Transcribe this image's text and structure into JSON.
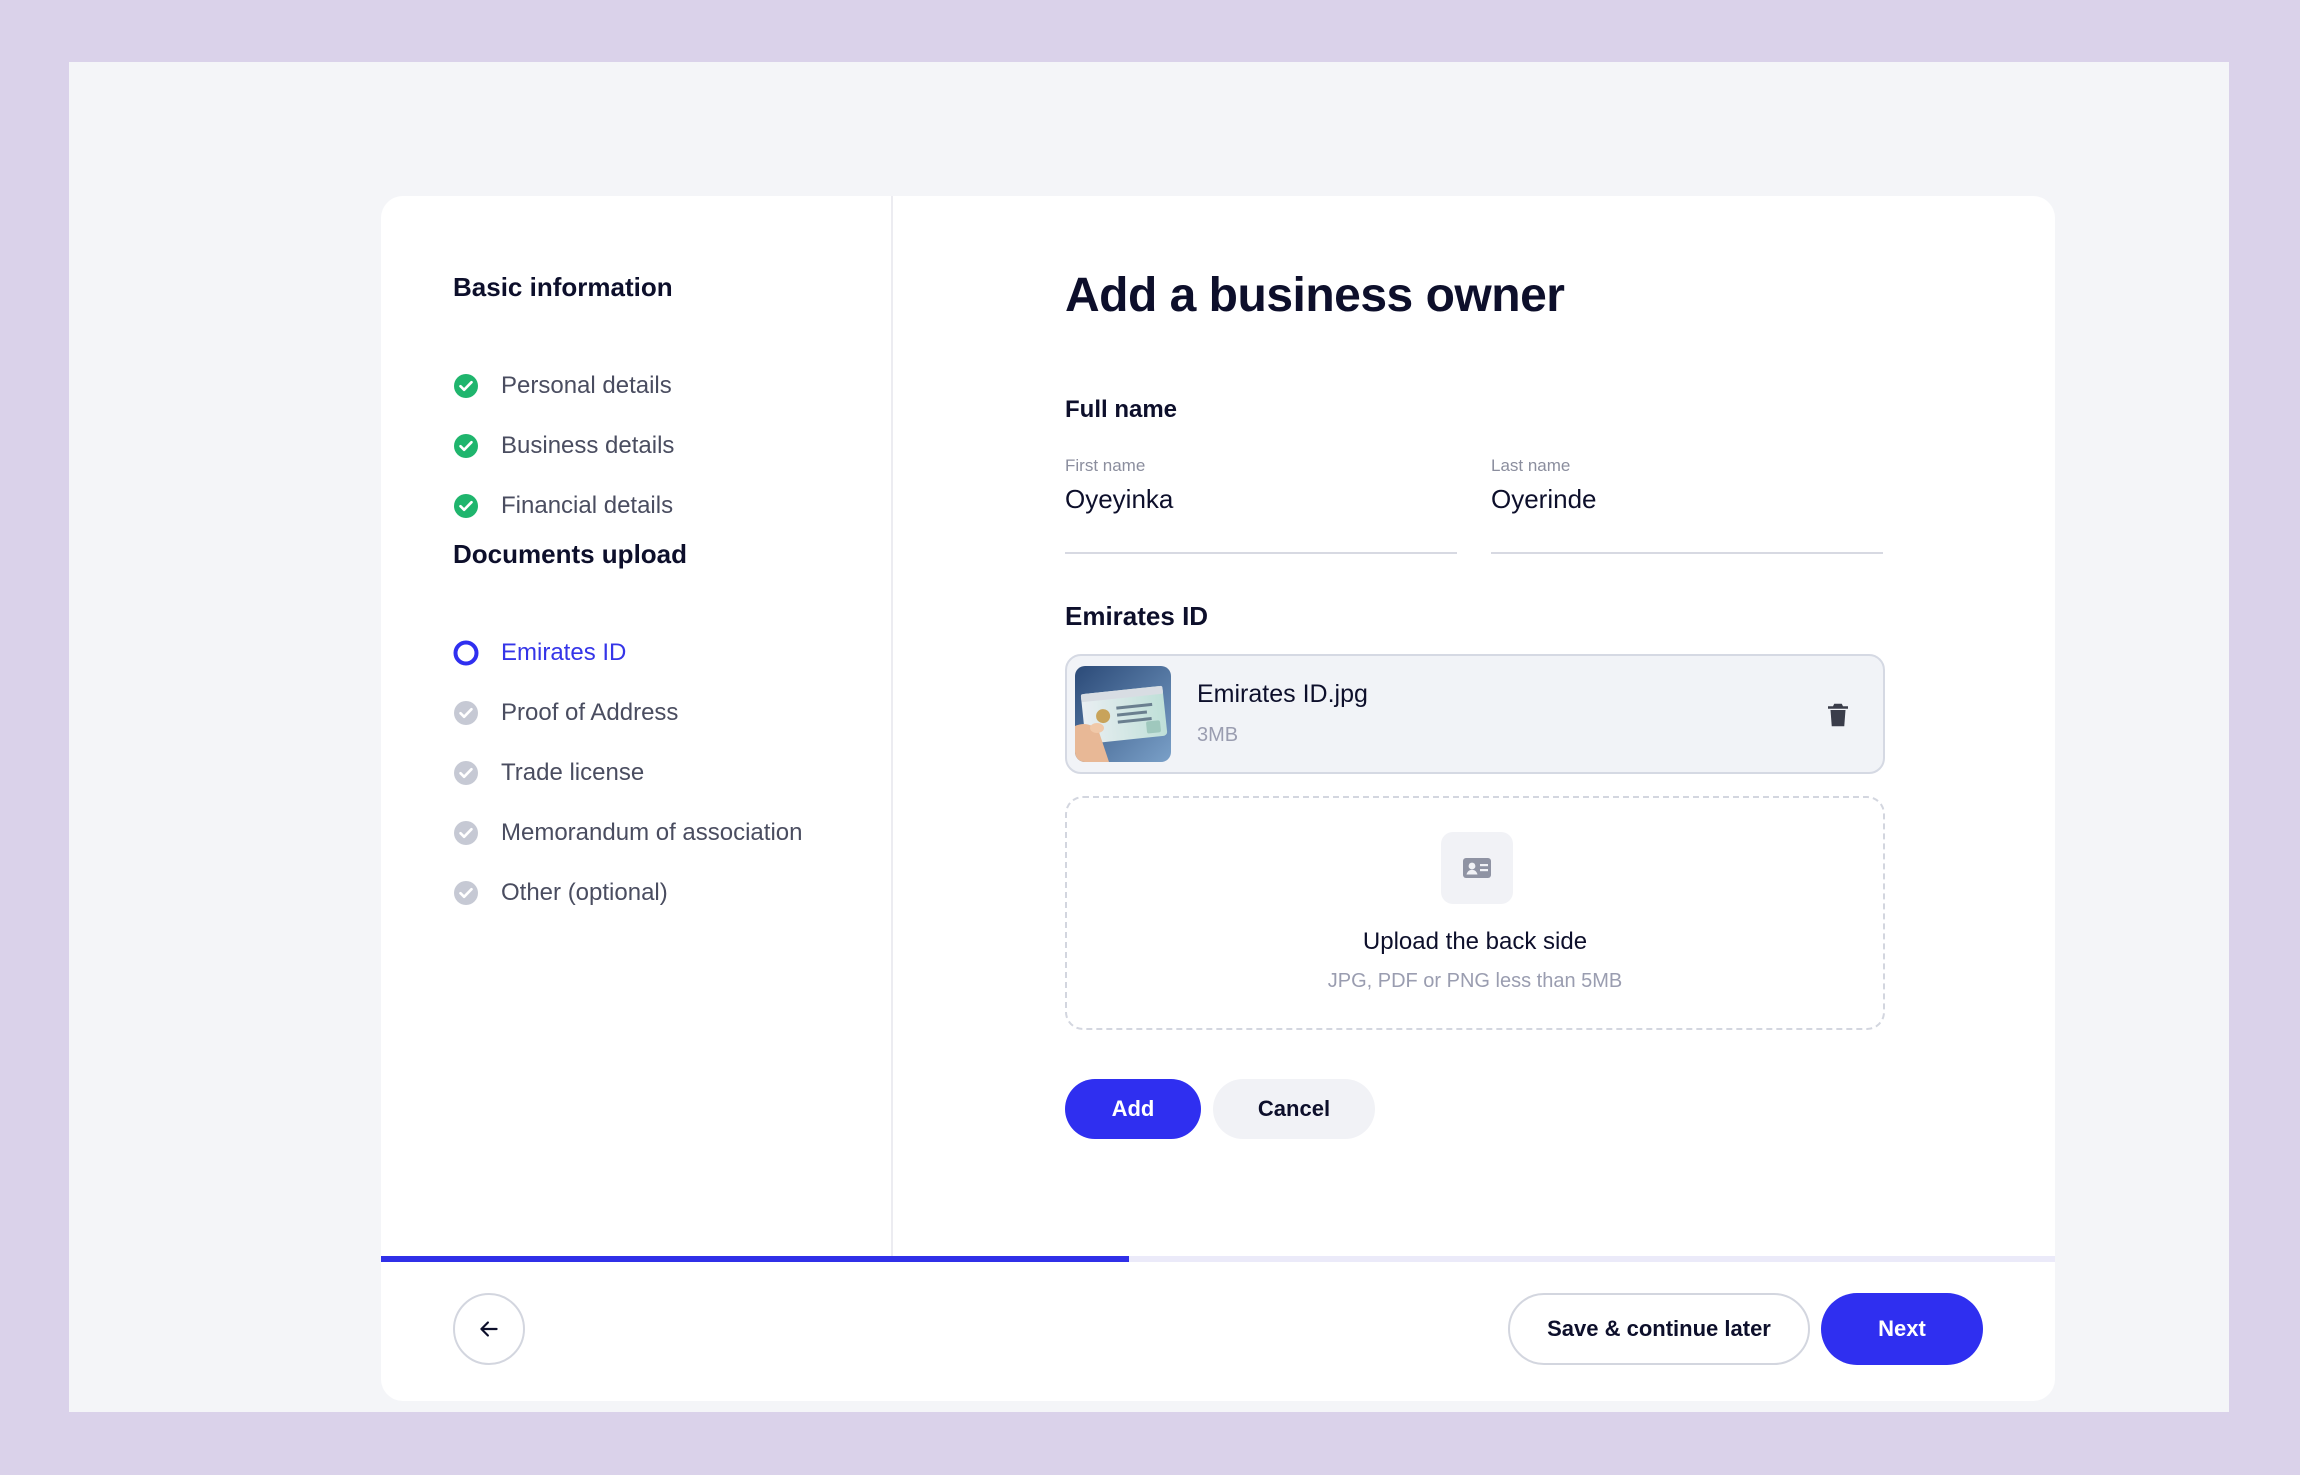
{
  "sidebar": {
    "basic_title": "Basic information",
    "basic_steps": [
      {
        "label": "Personal details",
        "status": "complete"
      },
      {
        "label": "Business details",
        "status": "complete"
      },
      {
        "label": "Financial details",
        "status": "complete"
      }
    ],
    "docs_title": "Documents upload",
    "doc_steps": [
      {
        "label": "Emirates ID",
        "status": "active"
      },
      {
        "label": "Proof of Address",
        "status": "pending"
      },
      {
        "label": "Trade license",
        "status": "pending"
      },
      {
        "label": "Memorandum of association",
        "status": "pending"
      },
      {
        "label": "Other (optional)",
        "status": "pending"
      }
    ]
  },
  "main": {
    "title": "Add a business owner",
    "full_name_label": "Full name",
    "first_name": {
      "label": "First name",
      "value": "Oyeyinka"
    },
    "last_name": {
      "label": "Last name",
      "value": "Oyerinde"
    },
    "emirates_label": "Emirates ID",
    "file": {
      "name": "Emirates ID.jpg",
      "size": "3MB"
    },
    "dropzone": {
      "title": "Upload the back side",
      "hint": "JPG, PDF or PNG less than 5MB"
    },
    "add_label": "Add",
    "cancel_label": "Cancel"
  },
  "progress": {
    "fraction": 0.447
  },
  "footer": {
    "save_label": "Save & continue later",
    "next_label": "Next"
  },
  "colors": {
    "accent": "#2f2ff0",
    "complete": "#1fb56d",
    "pending": "#c6c9d4",
    "background": "#dad2ea"
  }
}
